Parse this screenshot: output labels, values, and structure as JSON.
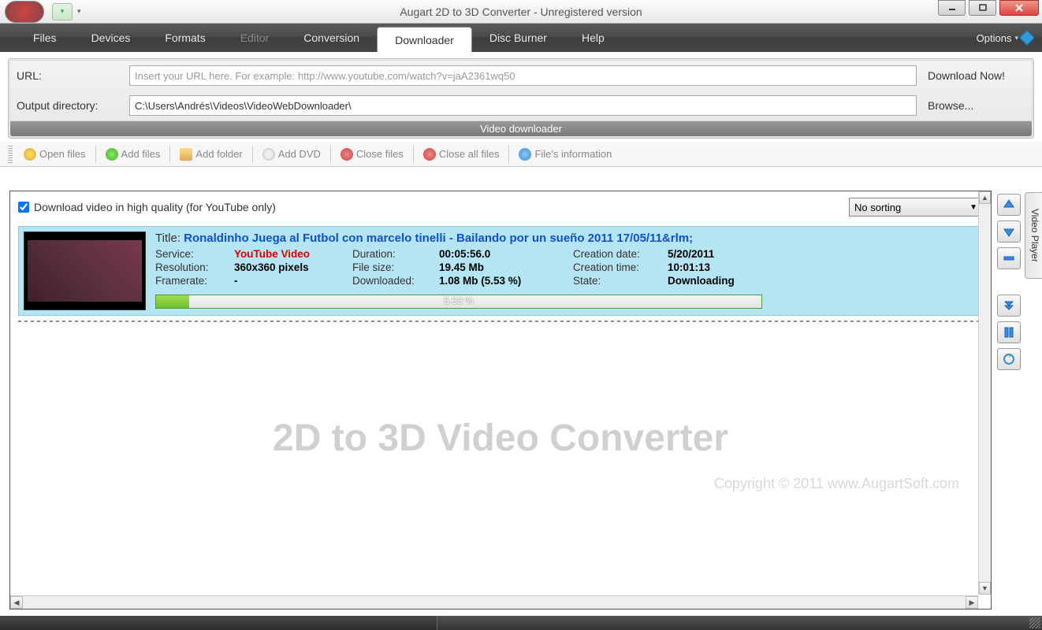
{
  "window": {
    "title": "Augart 2D to 3D Converter - Unregistered version"
  },
  "menu": {
    "items": [
      "Files",
      "Devices",
      "Formats",
      "Editor",
      "Conversion",
      "Downloader",
      "Disc Burner",
      "Help"
    ],
    "active": "Downloader",
    "disabled": [
      "Editor"
    ],
    "options_label": "Options"
  },
  "url_panel": {
    "url_label": "URL:",
    "url_placeholder": "Insert your URL here. For example: http://www.youtube.com/watch?v=jaA2361wq50",
    "url_value": "",
    "out_label": "Output directory:",
    "out_value": "C:\\Users\\Andrés\\Videos\\VideoWebDownloader\\",
    "download_now": "Download Now!",
    "browse": "Browse...",
    "caption": "Video downloader"
  },
  "toolbar": {
    "open": "Open files",
    "add": "Add files",
    "folder": "Add folder",
    "dvd": "Add DVD",
    "close": "Close files",
    "close_all": "Close all files",
    "info": "File's information"
  },
  "list": {
    "hq_checkbox": "Download video in high quality (for YouTube only)",
    "hq_checked": true,
    "sort_selected": "No sorting"
  },
  "item": {
    "title_label": "Title:",
    "title": "Ronaldinho Juega al Futbol con marcelo tinelli - Bailando por un sueño 2011 17/05/11&rlm;",
    "service_label": "Service:",
    "service": "YouTube Video",
    "resolution_label": "Resolution:",
    "resolution": "360x360 pixels",
    "framerate_label": "Framerate:",
    "framerate": "-",
    "duration_label": "Duration:",
    "duration": "00:05:56.0",
    "filesize_label": "File size:",
    "filesize": "19.45 Mb",
    "downloaded_label": "Downloaded:",
    "downloaded": "1.08 Mb (5.53 %)",
    "cdate_label": "Creation date:",
    "cdate": "5/20/2011",
    "ctime_label": "Creation time:",
    "ctime": "10:01:13",
    "state_label": "State:",
    "state": "Downloading",
    "progress_text": "5.53 %",
    "progress_pct": 5.53
  },
  "watermark": {
    "main": "2D to 3D Video Converter",
    "copyright": "Copyright © 2011 www.AugartSoft.com"
  },
  "side_tab": "Video Player"
}
